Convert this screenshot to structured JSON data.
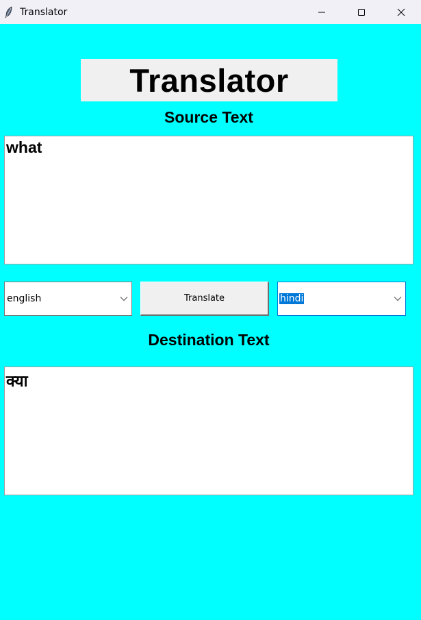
{
  "window": {
    "title": "Translator",
    "icon": "feather-icon",
    "controls": [
      "minimize-icon",
      "maximize-icon",
      "close-icon"
    ]
  },
  "header": {
    "title": "Translator"
  },
  "source": {
    "label": "Source Text",
    "text": "what"
  },
  "controls": {
    "source_language": "english",
    "translate_label": "Translate",
    "destination_language": "hindi"
  },
  "destination": {
    "label": "Destination Text",
    "text": "क्या"
  },
  "colors": {
    "background": "#00ffff",
    "header_box": "#f0f0f0",
    "selection": "#0078d7"
  }
}
